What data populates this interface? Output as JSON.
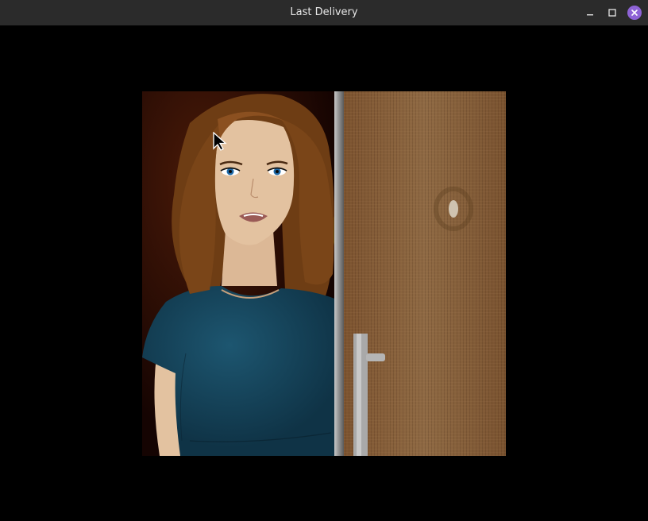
{
  "window": {
    "title": "Last Delivery",
    "controls": {
      "close_color": "#8e63d6"
    }
  },
  "scene": {
    "background_color": "#000000",
    "character": "woman-at-door",
    "colors": {
      "hair": "#7a4518",
      "skin": "#e3c2a0",
      "shirt": "#164257",
      "door": "#8b6138",
      "room": "#3a1206"
    }
  }
}
